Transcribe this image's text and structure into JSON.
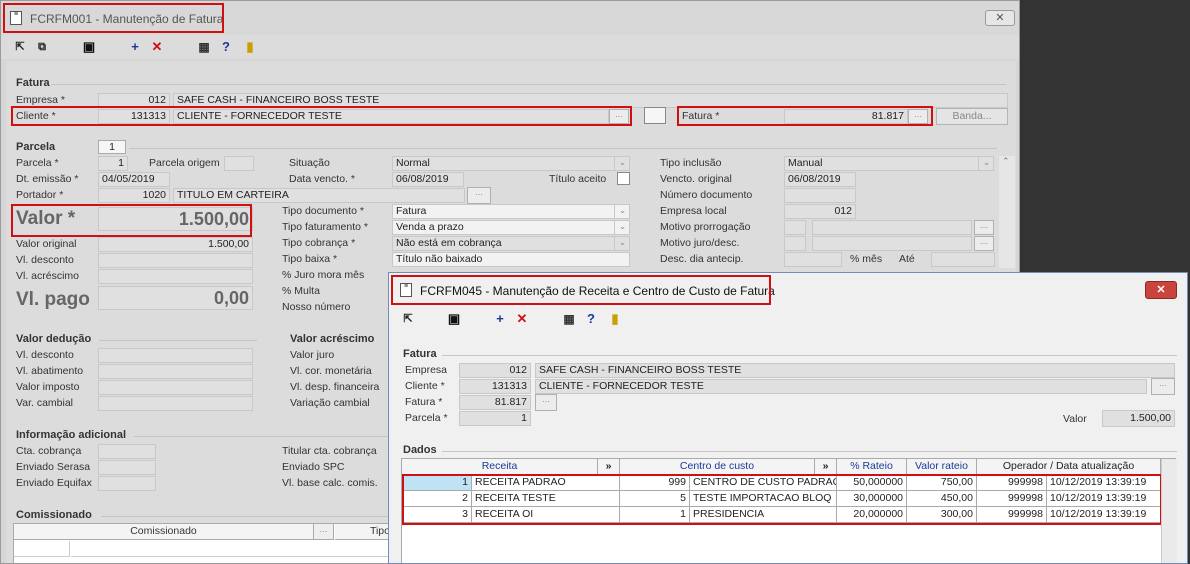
{
  "main_window": {
    "title": "FCRFM001 - Manutenção de Fatura",
    "close_label": "✕",
    "fatura_section": "Fatura",
    "empresa_label": "Empresa *",
    "empresa_code": "012",
    "empresa_name": "SAFE CASH - FINANCEIRO BOSS TESTE",
    "cliente_label": "Cliente *",
    "cliente_code": "131313",
    "cliente_name": "CLIENTE - FORNECEDOR TESTE",
    "fatura_label": "Fatura *",
    "fatura_value": "81.817",
    "banda_label": "Banda...",
    "parcela_section": "Parcela",
    "parcela_tab": "1",
    "parcela_label": "Parcela *",
    "parcela_value": "1",
    "parcela_origem_label": "Parcela origem",
    "dt_emissao_label": "Dt. emissão *",
    "dt_emissao_value": "04/05/2019",
    "portador_label": "Portador *",
    "portador_code": "1020",
    "portador_name": "TITULO EM CARTEIRA",
    "valor_label": "Valor *",
    "valor_value": "1.500,00",
    "valor_original_label": "Valor original",
    "valor_original_value": "1.500,00",
    "vl_desconto_label": "Vl. desconto",
    "vl_acrescimo_label": "Vl. acréscimo",
    "vl_pago_label": "Vl. pago",
    "vl_pago_value": "0,00",
    "situacao_label": "Situação",
    "situacao_value": "Normal",
    "data_vencto_label": "Data vencto. *",
    "data_vencto_value": "06/08/2019",
    "titulo_aceito_label": "Título aceito",
    "tipo_documento_label": "Tipo documento *",
    "tipo_documento_value": "Fatura",
    "tipo_faturamento_label": "Tipo faturamento *",
    "tipo_faturamento_value": "Venda a prazo",
    "tipo_cobranca_label": "Tipo cobrança *",
    "tipo_cobranca_value": "Não está em cobrança",
    "tipo_baixa_label": "Tipo baixa *",
    "tipo_baixa_value": "Título não baixado",
    "juro_mora_label": "% Juro mora mês",
    "multa_label": "% Multa",
    "nosso_numero_label": "Nosso número",
    "tipo_inclusao_label": "Tipo inclusão",
    "tipo_inclusao_value": "Manual",
    "vencto_original_label": "Vencto. original",
    "vencto_original_value": "06/08/2019",
    "numero_documento_label": "Número documento",
    "empresa_local_label": "Empresa local",
    "empresa_local_value": "012",
    "motivo_prorrogacao_label": "Motivo prorrogação",
    "motivo_juro_label": "Motivo juro/desc.",
    "desc_dia_antecip_label": "Desc. dia antecip.",
    "pct_mes_label": "% mês",
    "ate_label": "Até",
    "valor_deducao_section": "Valor dedução",
    "vl_desconto2_label": "Vl. desconto",
    "vl_abatimento_label": "Vl. abatimento",
    "valor_imposto_label": "Valor imposto",
    "var_cambial_label": "Var. cambial",
    "valor_acrescimo_section": "Valor acréscimo",
    "valor_juro_label": "Valor juro",
    "vl_cor_monetaria_label": "Vl. cor. monetária",
    "vl_desp_financeira_label": "Vl. desp. financeira",
    "variacao_cambial_label": "Variação cambial",
    "info_adicional_section": "Informação adicional",
    "cta_cobranca_label": "Cta. cobrança",
    "enviado_serasa_label": "Enviado Serasa",
    "enviado_equifax_label": "Enviado Equifax",
    "titular_cta_label": "Titular cta. cobrança",
    "enviado_spc_label": "Enviado SPC",
    "vl_base_calc_label": "Vl. base calc. comis.",
    "comissionado_section": "Comissionado",
    "comissionado_col": "Comissionado",
    "tipo_col": "Tipo"
  },
  "sub_window": {
    "title": "FCRFM045 - Manutenção de Receita e Centro de Custo de Fatura",
    "close_label": "✕",
    "fatura_section": "Fatura",
    "empresa_label": "Empresa",
    "empresa_code": "012",
    "empresa_name": "SAFE CASH - FINANCEIRO BOSS TESTE",
    "cliente_label": "Cliente *",
    "cliente_code": "131313",
    "cliente_name": "CLIENTE - FORNECEDOR TESTE",
    "fatura_label": "Fatura *",
    "fatura_value": "81.817",
    "parcela_label": "Parcela *",
    "parcela_value": "1",
    "valor_label": "Valor",
    "valor_value": "1.500,00",
    "dados_section": "Dados",
    "columns": {
      "receita": "Receita",
      "centro": "Centro de custo",
      "rateio": "% Rateio",
      "valor_rateio": "Valor rateio",
      "operador": "Operador / Data atualização",
      "expand": "»"
    },
    "rows": [
      {
        "idx": "1",
        "receita": "RECEITA PADRAO",
        "cc_code": "999",
        "cc_name": "CENTRO DE CUSTO PADRAO",
        "rateio": "50,000000",
        "valor": "750,00",
        "operador": "999998",
        "data": "10/12/2019 13:39:19"
      },
      {
        "idx": "2",
        "receita": "RECEITA TESTE",
        "cc_code": "5",
        "cc_name": "TESTE IMPORTACAO BLOQ",
        "rateio": "30,000000",
        "valor": "450,00",
        "operador": "999998",
        "data": "10/12/2019 13:39:19"
      },
      {
        "idx": "3",
        "receita": "RECEITA OI",
        "cc_code": "1",
        "cc_name": "PRESIDENCIA",
        "rateio": "20,000000",
        "valor": "300,00",
        "operador": "999998",
        "data": "10/12/2019 13:39:19"
      }
    ]
  },
  "colors": {
    "highlight": "#d01010",
    "accent_blue": "#1a3a9a"
  }
}
